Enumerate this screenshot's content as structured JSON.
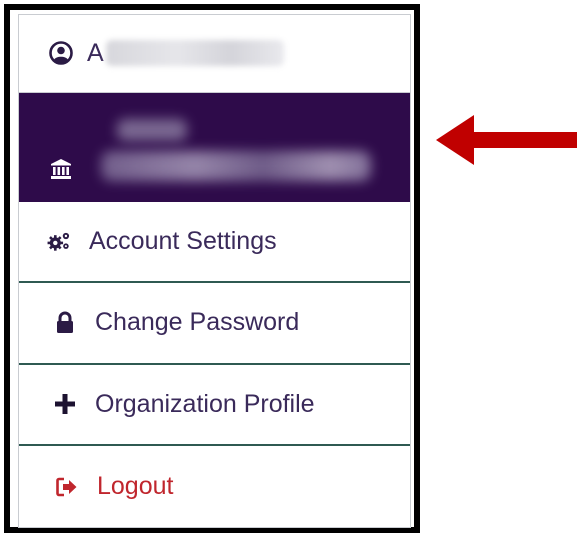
{
  "menu": {
    "user": {
      "initial": "A"
    },
    "items": [
      {
        "label": "Account Settings",
        "icon": "gears-icon"
      },
      {
        "label": "Change Password",
        "icon": "lock-icon"
      },
      {
        "label": "Organization Profile",
        "icon": "plus-icon"
      },
      {
        "label": "Logout",
        "icon": "sign-out-icon"
      }
    ]
  },
  "colors": {
    "org_background": "#2e0b4a",
    "menu_text": "#3a2a5a",
    "logout": "#c0262d",
    "divider": "#2f5a52",
    "arrow": "#c00000"
  }
}
